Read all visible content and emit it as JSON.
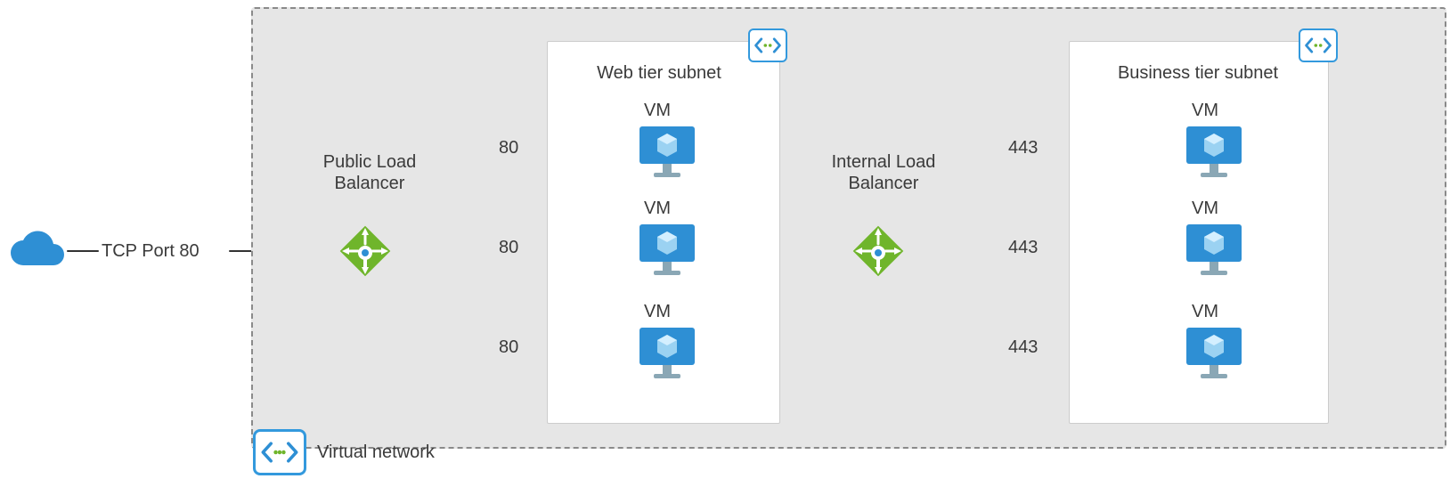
{
  "cloud_label": "TCP Port 80",
  "vnet_label": "Virtual network",
  "public_lb_label": "Public Load\nBalancer",
  "internal_lb_label": "Internal Load\nBalancer",
  "web_subnet_title": "Web tier subnet",
  "business_subnet_title": "Business tier subnet",
  "vm_label": "VM",
  "port_web": "80",
  "port_biz": "443",
  "colors": {
    "azure_blue": "#2e8fd4",
    "lb_green": "#6fb52b",
    "text": "#3a3a3a",
    "panel_bg": "#e6e6e6"
  },
  "structure": {
    "flow": [
      "Internet cloud",
      "TCP Port 80",
      "Public Load Balancer",
      "Web tier subnet — 3 VMs on port 80",
      "Internal Load Balancer",
      "Business tier subnet — 3 VMs on port 443"
    ]
  }
}
